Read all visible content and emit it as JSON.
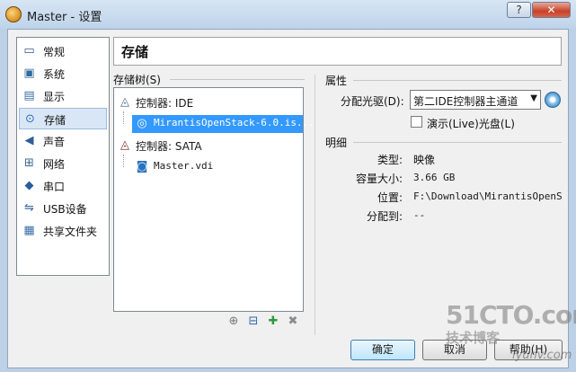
{
  "window": {
    "title": "Master - 设置",
    "help_glyph": "?",
    "close_glyph": "✕"
  },
  "sidebar": {
    "items": [
      {
        "label": "常规",
        "icon": "monitor-icon",
        "glyph": "▭"
      },
      {
        "label": "系统",
        "icon": "motherboard-icon",
        "glyph": "▣"
      },
      {
        "label": "显示",
        "icon": "display-icon",
        "glyph": "▤"
      },
      {
        "label": "存储",
        "icon": "storage-icon",
        "glyph": "⊙"
      },
      {
        "label": "声音",
        "icon": "speaker-icon",
        "glyph": "◀"
      },
      {
        "label": "网络",
        "icon": "network-icon",
        "glyph": "⊞"
      },
      {
        "label": "串口",
        "icon": "serial-port-icon",
        "glyph": "◆"
      },
      {
        "label": "USB设备",
        "icon": "usb-icon",
        "glyph": "⇋"
      },
      {
        "label": "共享文件夹",
        "icon": "shared-folder-icon",
        "glyph": "▦"
      }
    ],
    "selected_index": 3
  },
  "main": {
    "title": "存储"
  },
  "storage_tree": {
    "label": "存储树(S)",
    "controllers": [
      {
        "name": "控制器: IDE",
        "icon": "ide-controller-icon",
        "glyph": "◬",
        "attachments": [
          {
            "name": "MirantisOpenStack-6.0.is...",
            "icon": "optical-disc-icon",
            "glyph": "◎",
            "selected": true
          }
        ]
      },
      {
        "name": "控制器: SATA",
        "icon": "sata-controller-icon",
        "glyph": "◬",
        "attachments": [
          {
            "name": "Master.vdi",
            "icon": "hard-disk-icon",
            "glyph": "◙",
            "selected": false
          }
        ]
      }
    ],
    "toolbar": [
      {
        "icon": "add-attachment-icon",
        "glyph": "⊕"
      },
      {
        "icon": "remove-attachment-icon",
        "glyph": "⊟"
      },
      {
        "icon": "add-controller-icon",
        "glyph": "✚"
      },
      {
        "icon": "remove-controller-icon",
        "glyph": "✖"
      }
    ]
  },
  "attributes": {
    "label": "属性",
    "drive_label": "分配光驱(D):",
    "drive_value": "第二IDE控制器主通道",
    "combo_arrow_glyph": "▼",
    "live_cd_label": "演示(Live)光盘(L)",
    "live_cd_checked": false
  },
  "details": {
    "label": "明细",
    "rows": [
      {
        "key": "类型:",
        "value": "映像"
      },
      {
        "key": "容量大小:",
        "value": "3.66  GB"
      },
      {
        "key": "位置:",
        "value": "F:\\Download\\MirantisOpenS"
      },
      {
        "key": "分配到:",
        "value": "--"
      }
    ]
  },
  "buttons": {
    "ok": "确定",
    "cancel": "取消",
    "help": "帮助(H)"
  },
  "watermark": {
    "line1": "51CTO.com",
    "line2": "技术博客",
    "line3": "iyunv.com"
  },
  "colors": {
    "selection": "#3399ff",
    "title_bar": "#bed3ea"
  }
}
